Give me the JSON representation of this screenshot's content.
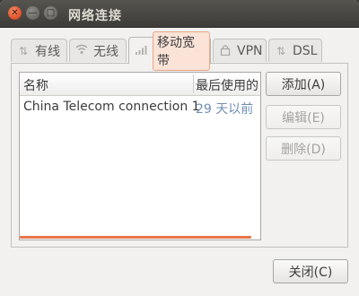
{
  "window": {
    "title": "网络连接",
    "controls": {
      "close": "✕",
      "minimize": "—",
      "maximize": "□"
    }
  },
  "tabs": [
    {
      "label": "有线",
      "icon": "wired-icon",
      "active": false
    },
    {
      "label": "无线",
      "icon": "wifi-icon",
      "active": false
    },
    {
      "label": "移动宽带",
      "icon": "mobile-signal-icon",
      "active": true
    },
    {
      "label": "VPN",
      "icon": "lock-icon",
      "active": false
    },
    {
      "label": "DSL",
      "icon": "dsl-icon",
      "active": false
    }
  ],
  "table": {
    "columns": [
      "名称",
      "最后使用的"
    ],
    "rows": [
      {
        "name": "China Telecom connection 1",
        "last_used": "29 天以前"
      }
    ]
  },
  "buttons": {
    "add": "添加(A)",
    "edit": "编辑(E)",
    "delete": "删除(D)",
    "close": "关闭(C)"
  },
  "colors": {
    "accent": "#e9744a",
    "active_tab_highlight": "#fbe3d8",
    "time_text": "#6f8fb5"
  }
}
